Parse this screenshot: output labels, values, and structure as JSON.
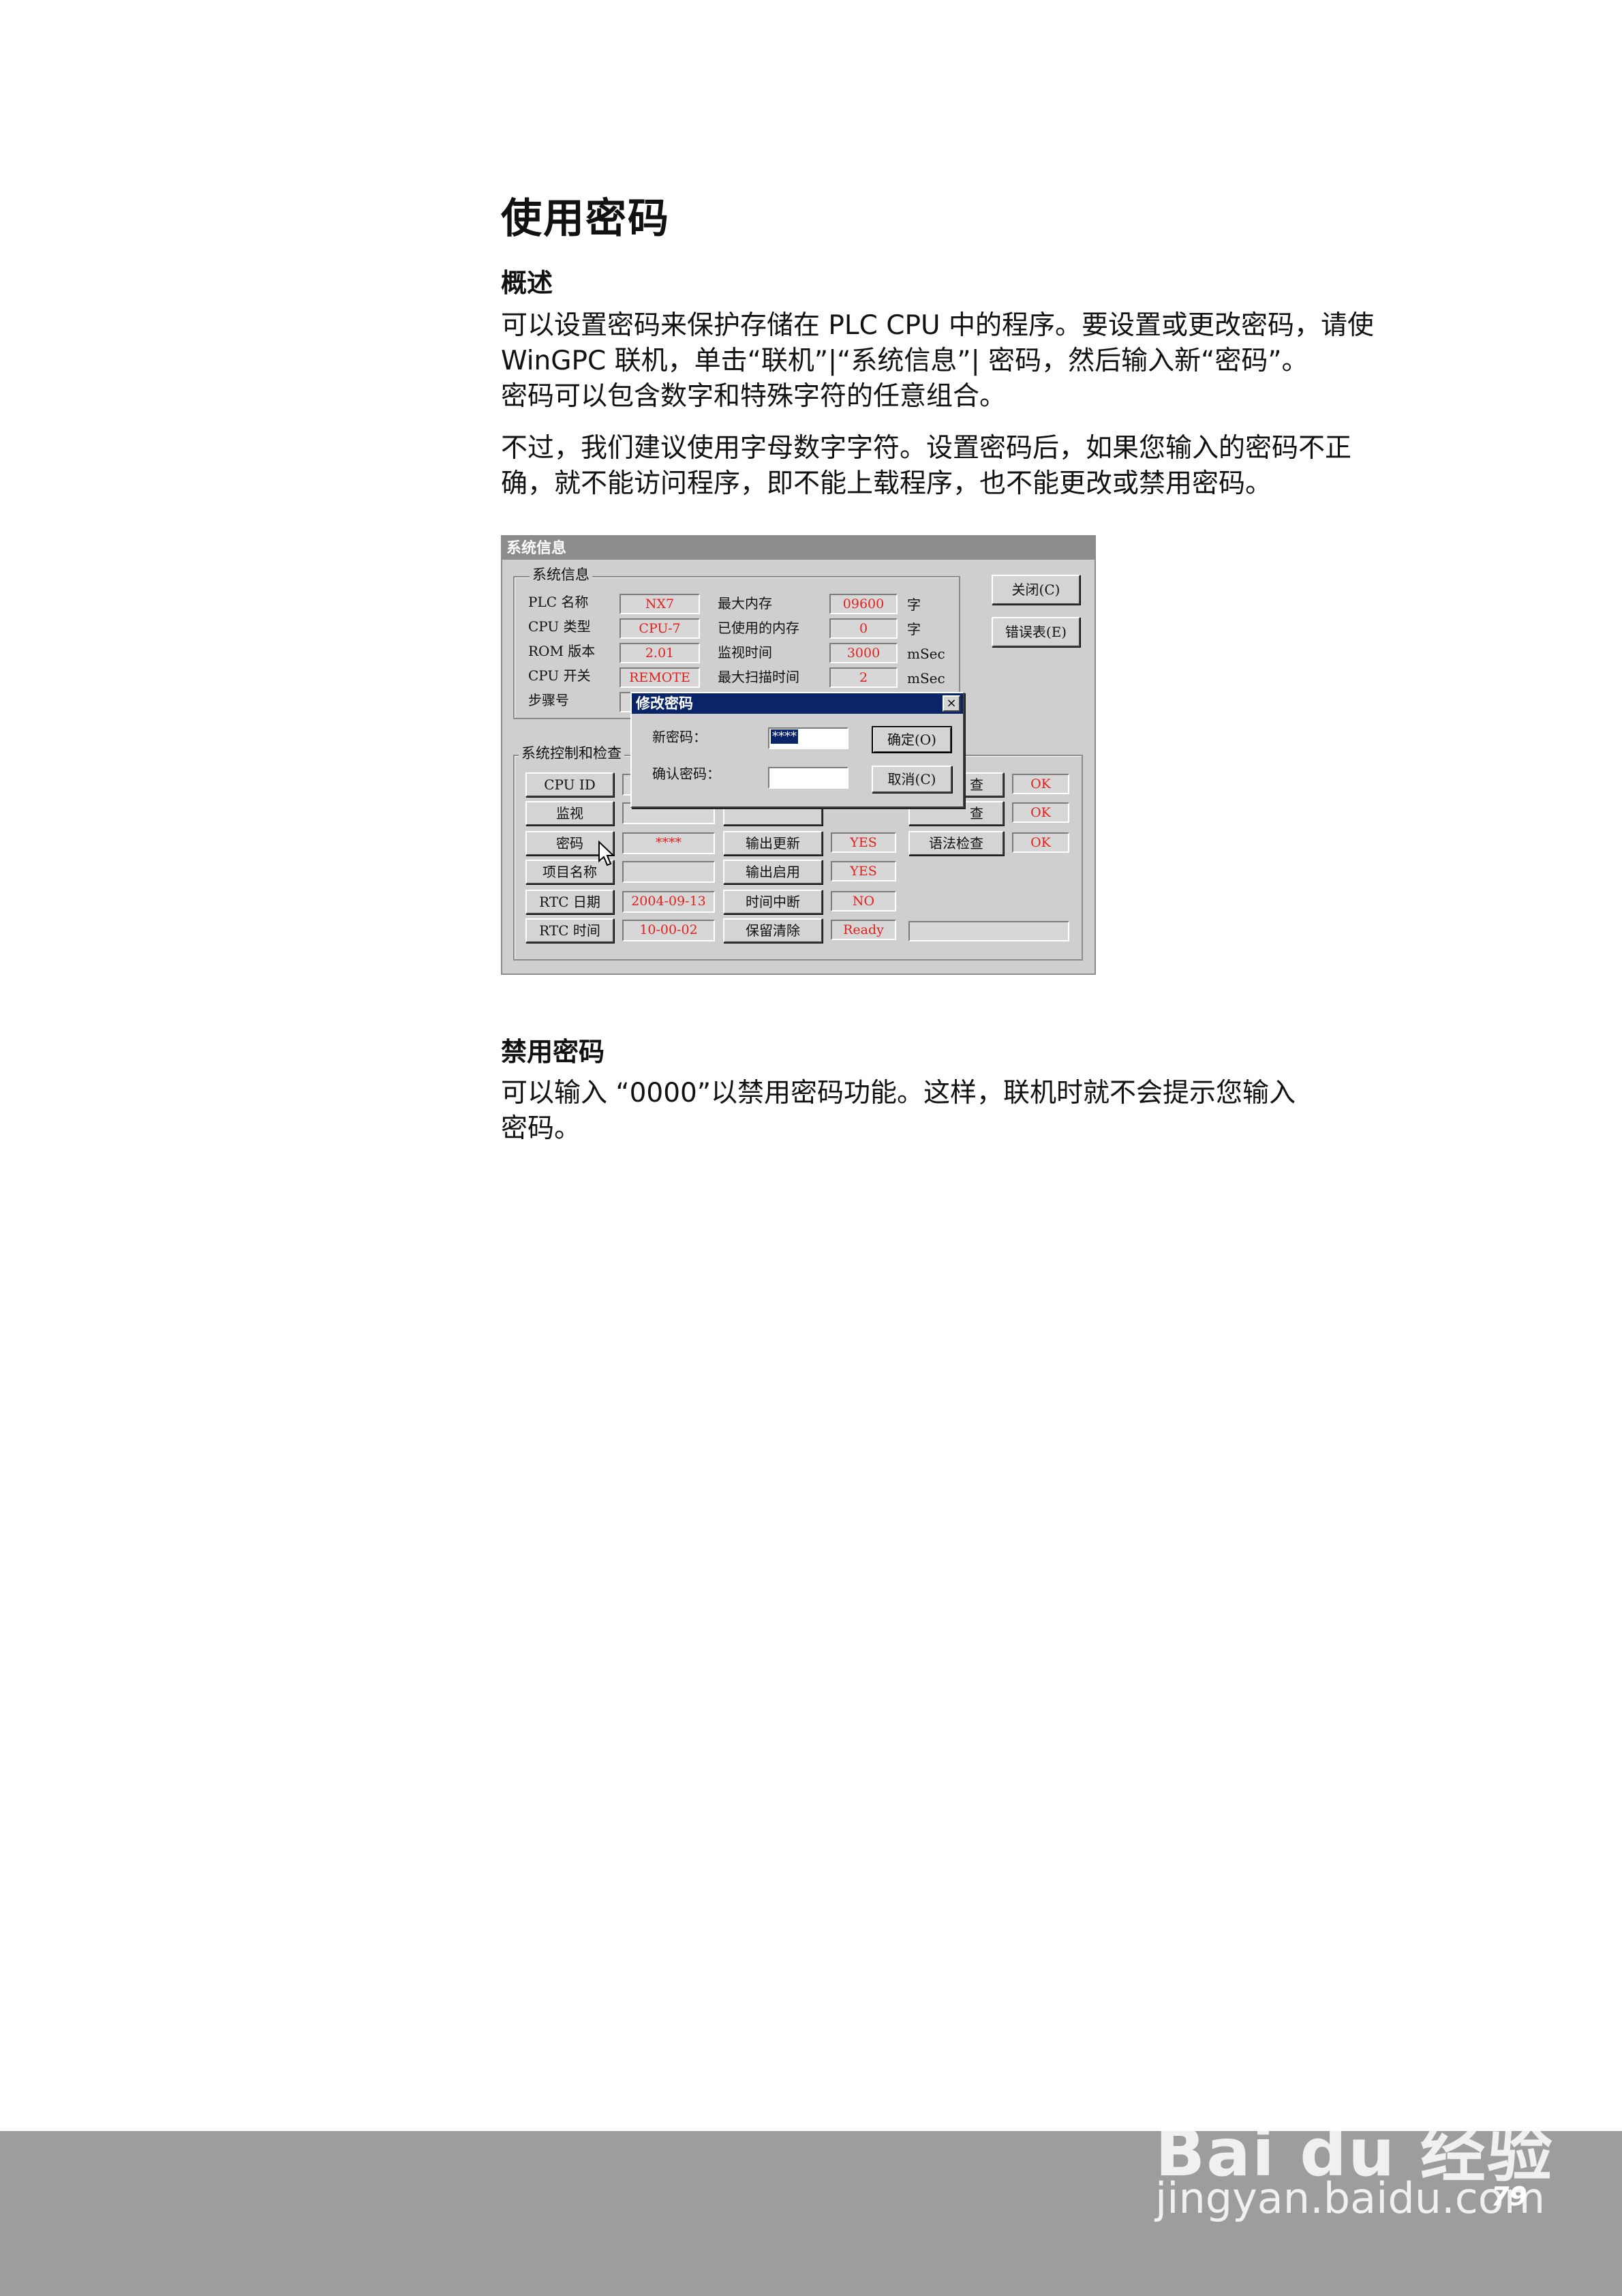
{
  "title": "使用密码",
  "overview": {
    "heading": "概述",
    "para1_line1": "可以设置密码来保护存储在 PLC CPU 中的程序。要设置或更改密码，请使",
    "para1_line2": "WinGPC 联机，单击“联机”|“系统信息”| 密码，然后输入新“密码”。",
    "para1_line3": "密码可以包含数字和特殊字符的任意组合。",
    "para2_line1": "不过，我们建议使用字母数字字符。设置密码后，如果您输入的密码不正",
    "para2_line2": "确，就不能访问程序，即不能上载程序，也不能更改或禁用密码。"
  },
  "screenshot": {
    "window_title": "系统信息",
    "group1_title": "系统信息",
    "rows": [
      {
        "label": "PLC 名称",
        "value": "NX7",
        "label2": "最大内存",
        "value2": "09600",
        "unit": "字"
      },
      {
        "label": "CPU 类型",
        "value": "CPU-7",
        "label2": "已使用的内存",
        "value2": "0",
        "unit": "字"
      },
      {
        "label": "ROM 版本",
        "value": "2.01",
        "label2": "监视时间",
        "value2": "3000",
        "unit": "mSec"
      },
      {
        "label": "CPU 开关",
        "value": "REMOTE",
        "label2": "最大扫描时间",
        "value2": "2",
        "unit": "mSec"
      },
      {
        "label": "步骤号",
        "value": "",
        "label2": "",
        "value2": "",
        "unit": ""
      }
    ],
    "close_button": "关闭(C)",
    "error_table_button": "错误表(E)",
    "group2_title": "系统控制和检查",
    "ctrl_buttons": [
      "CPU ID",
      "监视",
      "密码",
      "项目名称",
      "RTC 日期",
      "RTC 时间"
    ],
    "ctrl_values": [
      "",
      "",
      "****",
      "",
      "2004-09-13",
      "10-00-02"
    ],
    "mid_buttons": [
      "",
      "",
      "输出更新",
      "输出启用",
      "时间中断",
      "保留清除"
    ],
    "mid_values": [
      "",
      "",
      "YES",
      "YES",
      "NO",
      "Ready"
    ],
    "check_buttons": [
      "查",
      "查",
      "语法检查"
    ],
    "check_values": [
      "OK",
      "OK",
      "OK"
    ],
    "dialog": {
      "title": "修改密码",
      "close": "×",
      "new_pw_label": "新密码：",
      "new_pw_value": "****",
      "confirm_pw_label": "确认密码：",
      "confirm_pw_value": "",
      "ok_button": "确定(O)",
      "cancel_button": "取消(C)"
    }
  },
  "disable": {
    "heading": "禁用密码",
    "line1": "可以输入 “0000”以禁用密码功能。这样，联机时就不会提示您输入",
    "line2": "密码。"
  },
  "page_number": "79",
  "watermark": {
    "brand": "Bai du 经验",
    "url": "jingyan.baidu.com"
  }
}
